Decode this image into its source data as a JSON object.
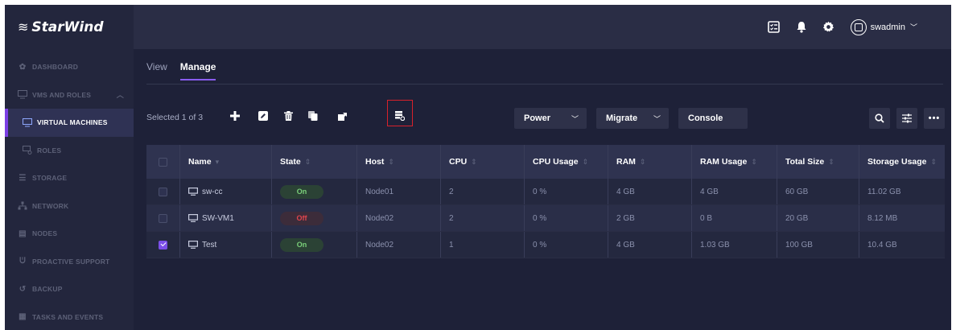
{
  "brand": {
    "name": "StarWind"
  },
  "sidebar": {
    "items": [
      {
        "label": "DASHBOARD",
        "icon": "dashboard-icon"
      },
      {
        "label": "VMS AND ROLES",
        "icon": "vms-roles-icon"
      },
      {
        "label": "VIRTUAL MACHINES",
        "icon": "monitor-icon"
      },
      {
        "label": "ROLES",
        "icon": "roles-icon"
      },
      {
        "label": "STORAGE",
        "icon": "storage-icon"
      },
      {
        "label": "NETWORK",
        "icon": "network-icon"
      },
      {
        "label": "NODES",
        "icon": "nodes-icon"
      },
      {
        "label": "PROACTIVE SUPPORT",
        "icon": "support-icon"
      },
      {
        "label": "BACKUP",
        "icon": "backup-icon"
      },
      {
        "label": "TASKS AND EVENTS",
        "icon": "tasks-icon"
      }
    ]
  },
  "header": {
    "username": "swadmin"
  },
  "tabs": [
    {
      "label": "View"
    },
    {
      "label": "Manage"
    }
  ],
  "toolbar": {
    "selection": "Selected 1 of 3",
    "power_label": "Power",
    "migrate_label": "Migrate",
    "console_label": "Console"
  },
  "table": {
    "columns": [
      "Name",
      "State",
      "Host",
      "CPU",
      "CPU Usage",
      "RAM",
      "RAM Usage",
      "Total Size",
      "Storage Usage"
    ],
    "rows": [
      {
        "name": "sw-cc",
        "state": "On",
        "host": "Node01",
        "cpu": "2",
        "cpu_usage": "0 %",
        "ram": "4 GB",
        "ram_usage": "4 GB",
        "total_size": "60 GB",
        "storage_usage": "11.02 GB",
        "checked": false
      },
      {
        "name": "SW-VM1",
        "state": "Off",
        "host": "Node02",
        "cpu": "2",
        "cpu_usage": "0 %",
        "ram": "2 GB",
        "ram_usage": "0 B",
        "total_size": "20 GB",
        "storage_usage": "8.12 MB",
        "checked": false
      },
      {
        "name": "Test",
        "state": "On",
        "host": "Node02",
        "cpu": "1",
        "cpu_usage": "0 %",
        "ram": "4 GB",
        "ram_usage": "1.03 GB",
        "total_size": "100 GB",
        "storage_usage": "10.4 GB",
        "checked": true
      }
    ]
  },
  "colors": {
    "accent": "#7b3fe4",
    "state_on": "#7ad07a",
    "state_off": "#e0454d",
    "highlight_box": "#d8212b"
  }
}
